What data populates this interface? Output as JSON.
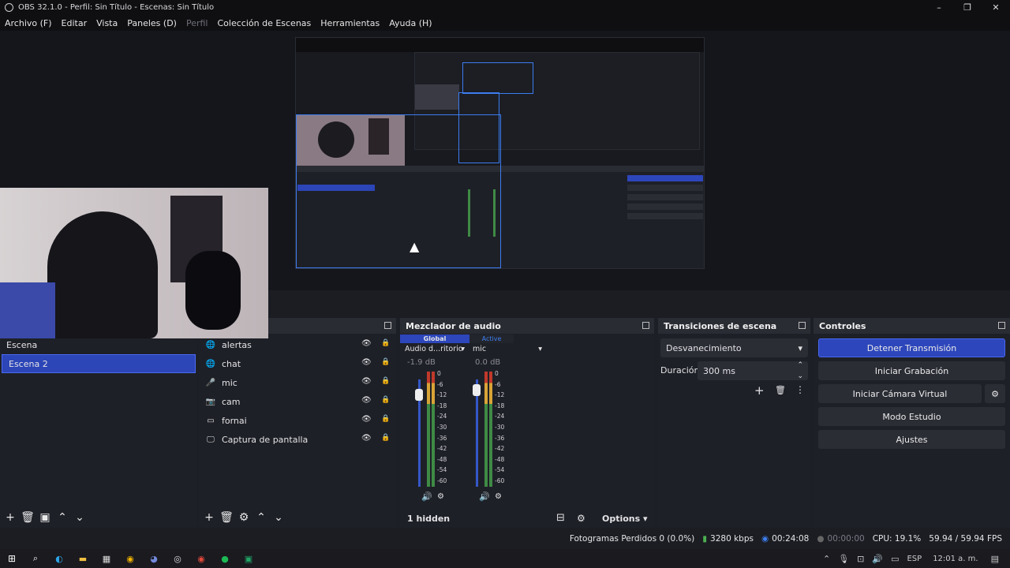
{
  "window": {
    "title": "OBS 32.1.0 - Perfil: Sin Título - Escenas: Sin Título"
  },
  "menu": [
    "Archivo (F)",
    "Editar",
    "Vista",
    "Paneles (D)",
    "Perfil",
    "Colección de Escenas",
    "Herramientas",
    "Ayuda (H)"
  ],
  "scenes": {
    "items": [
      "Escena",
      "Escena 2"
    ],
    "selected": 1
  },
  "sources": {
    "items": [
      {
        "name": "alertas",
        "icon": "globe-icon"
      },
      {
        "name": "chat",
        "icon": "globe-icon"
      },
      {
        "name": "mic",
        "icon": "microphone-icon"
      },
      {
        "name": "cam",
        "icon": "camera-icon"
      },
      {
        "name": "fornai",
        "icon": "window-icon"
      },
      {
        "name": "Captura de pantalla",
        "icon": "monitor-icon"
      }
    ]
  },
  "mixer": {
    "title": "Mezclador de audio",
    "tabs": [
      "Global",
      "Active"
    ],
    "channels": [
      {
        "name": "Audio d...ritorio",
        "db": "-1.9 dB",
        "level": 0.92
      },
      {
        "name": "mic",
        "db": "0.0 dB",
        "level": 0.97
      }
    ],
    "scale": [
      "0",
      "-6",
      "-12",
      "-18",
      "-24",
      "-30",
      "-36",
      "-42",
      "-48",
      "-54",
      "-60"
    ],
    "hidden_label": "1 hidden",
    "options_label": "Options"
  },
  "transitions": {
    "title": "Transiciones de escena",
    "selected": "Desvanecimiento",
    "duration_label": "Duración",
    "duration_value": "300 ms"
  },
  "controls": {
    "title": "Controles",
    "buttons": [
      "Detener Transmisión",
      "Iniciar Grabación",
      "Iniciar Cámara Virtual",
      "Modo Estudio",
      "Ajustes"
    ]
  },
  "status": {
    "dropped": "Fotogramas Perdidos 0 (0.0%)",
    "bitrate": "3280 kbps",
    "stream_time": "00:24:08",
    "rec_time": "00:00:00",
    "cpu": "CPU: 19.1%",
    "fps": "59.94 / 59.94 FPS"
  },
  "taskbar": {
    "lang": "ESP",
    "clock": "12:01 a. m."
  },
  "colors": {
    "accent": "#2d46bb",
    "live": "#3d7ff0",
    "meter_green": "#4caf50",
    "meter_red": "#c0392b"
  }
}
